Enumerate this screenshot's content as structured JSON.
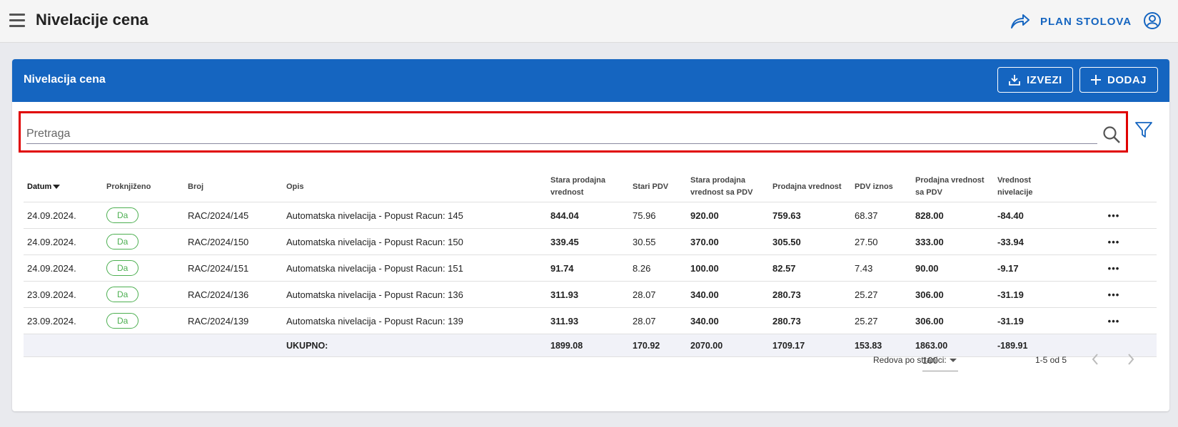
{
  "topbar": {
    "title": "Nivelacije cena",
    "plan_label": "PLAN STOLOVA"
  },
  "card": {
    "title": "Nivelacija cena",
    "export_label": "IZVEZI",
    "add_label": "DODAJ"
  },
  "search": {
    "placeholder": "Pretraga"
  },
  "table": {
    "headers": [
      "Datum",
      "Proknjiženo",
      "Broj",
      "Opis",
      "Stara prodajna vrednost",
      "Stari PDV",
      "Stara prodajna vrednost sa PDV",
      "Prodajna vrednost",
      "PDV iznos",
      "Prodajna vrednost sa PDV",
      "Vrednost nivelacije"
    ],
    "rows": [
      {
        "datum": "24.09.2024.",
        "status": "Da",
        "broj": "RAC/2024/145",
        "opis": "Automatska nivelacija - Popust Racun: 145",
        "stara": "844.04",
        "stari_pdv": "75.96",
        "stara_pdv": "920.00",
        "prodajna": "759.63",
        "pdv": "68.37",
        "prodajna_pdv": "828.00",
        "nivelacija": "-84.40"
      },
      {
        "datum": "24.09.2024.",
        "status": "Da",
        "broj": "RAC/2024/150",
        "opis": "Automatska nivelacija - Popust Racun: 150",
        "stara": "339.45",
        "stari_pdv": "30.55",
        "stara_pdv": "370.00",
        "prodajna": "305.50",
        "pdv": "27.50",
        "prodajna_pdv": "333.00",
        "nivelacija": "-33.94"
      },
      {
        "datum": "24.09.2024.",
        "status": "Da",
        "broj": "RAC/2024/151",
        "opis": "Automatska nivelacija - Popust Racun: 151",
        "stara": "91.74",
        "stari_pdv": "8.26",
        "stara_pdv": "100.00",
        "prodajna": "82.57",
        "pdv": "7.43",
        "prodajna_pdv": "90.00",
        "nivelacija": "-9.17"
      },
      {
        "datum": "23.09.2024.",
        "status": "Da",
        "broj": "RAC/2024/136",
        "opis": "Automatska nivelacija - Popust Racun: 136",
        "stara": "311.93",
        "stari_pdv": "28.07",
        "stara_pdv": "340.00",
        "prodajna": "280.73",
        "pdv": "25.27",
        "prodajna_pdv": "306.00",
        "nivelacija": "-31.19"
      },
      {
        "datum": "23.09.2024.",
        "status": "Da",
        "broj": "RAC/2024/139",
        "opis": "Automatska nivelacija - Popust Racun: 139",
        "stara": "311.93",
        "stari_pdv": "28.07",
        "stara_pdv": "340.00",
        "prodajna": "280.73",
        "pdv": "25.27",
        "prodajna_pdv": "306.00",
        "nivelacija": "-31.19"
      }
    ],
    "total": {
      "label": "UKUPNO:",
      "stara": "1899.08",
      "stari_pdv": "170.92",
      "stara_pdv": "2070.00",
      "prodajna": "1709.17",
      "pdv": "153.83",
      "prodajna_pdv": "1863.00",
      "nivelacija": "-189.91"
    }
  },
  "pagination": {
    "rows_label": "Redova po stranici:",
    "rows_value": "100",
    "range": "1-5 od 5"
  },
  "colors": {
    "primary": "#1565c0",
    "old_value": "#f03a3a",
    "new_value": "#1565c0",
    "difference": "#c9950a",
    "status": "#4caf50",
    "highlight": "#e00000"
  }
}
